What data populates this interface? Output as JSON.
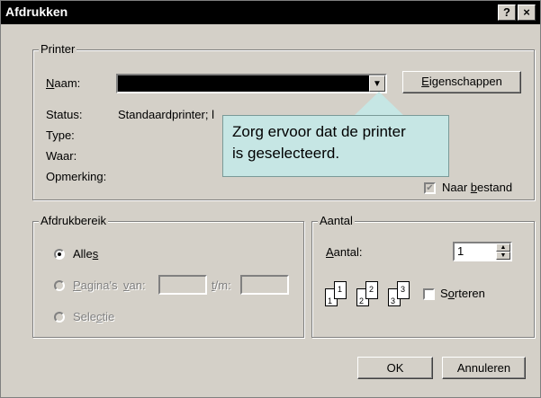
{
  "window": {
    "title": "Afdrukken",
    "help_button": "?",
    "close_button": "×"
  },
  "printer": {
    "legend": "Printer",
    "name_label": "Naam:",
    "name_value": "",
    "properties_button": "Eigenschappen",
    "status_label": "Status:",
    "status_value": "Standaardprinter; l",
    "type_label": "Type:",
    "where_label": "Waar:",
    "comment_label": "Opmerking:",
    "print_to_file_label": "Naar bestand",
    "print_to_file_checked": true
  },
  "callout": {
    "line1": "Zorg ervoor dat de printer",
    "line2": "is geselecteerd."
  },
  "range": {
    "legend": "Afdrukbereik",
    "all_label": "Alles",
    "pages_label": "Pagina's",
    "from_label": "van:",
    "to_label": "t/m:",
    "selection_label": "Selectie",
    "selected": "Alles"
  },
  "copies": {
    "legend": "Aantal",
    "count_label": "Aantal:",
    "count_value": "1",
    "collate_label": "Sorteren",
    "collate_checked": false,
    "collate_pages": [
      "1",
      "1",
      "2",
      "2",
      "3",
      "3"
    ]
  },
  "buttons": {
    "ok": "OK",
    "cancel": "Annuleren"
  }
}
